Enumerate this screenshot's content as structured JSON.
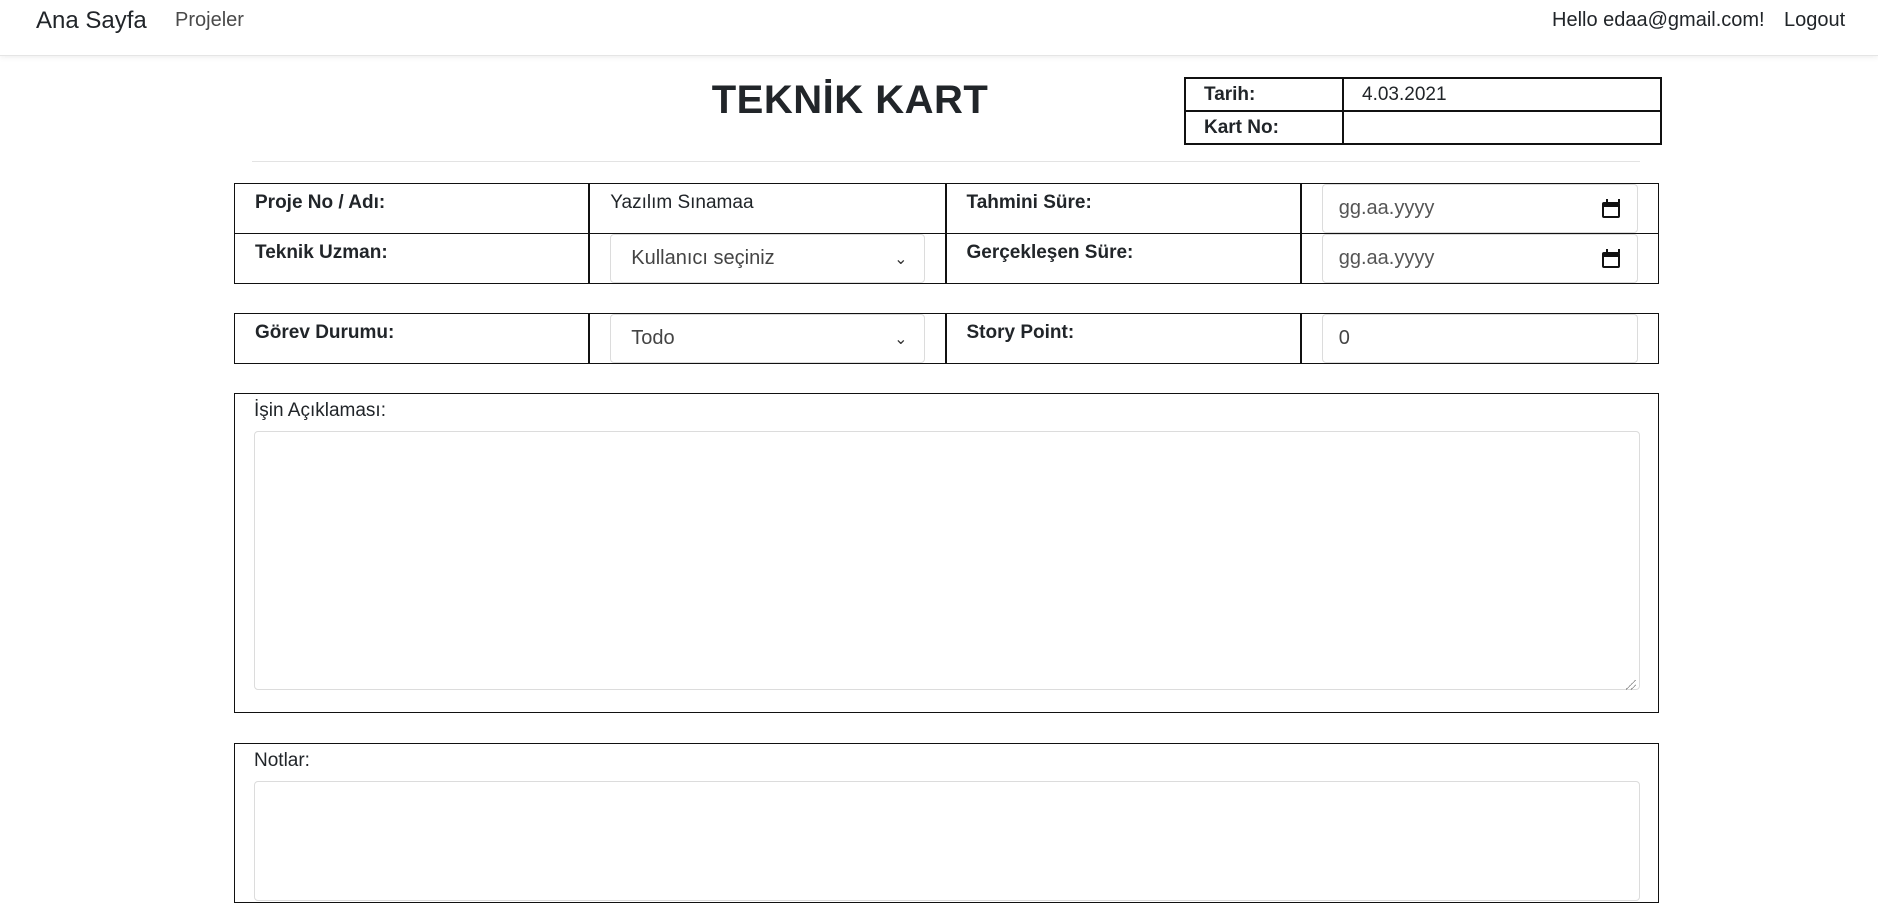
{
  "nav": {
    "brand": "Ana Sayfa",
    "projects": "Projeler",
    "greeting": "Hello edaa@gmail.com!",
    "logout": "Logout"
  },
  "card": {
    "title": "TEKNİK KART",
    "date_label": "Tarih:",
    "date_value": "4.03.2021",
    "card_no_label": "Kart No:",
    "card_no_value": ""
  },
  "form": {
    "project_label": "Proje No / Adı:",
    "project_value": "Yazılım Sınamaa",
    "estimated_label": "Tahmini Süre:",
    "estimated_placeholder": "gg.aa.yyyy",
    "expert_label": "Teknik Uzman:",
    "expert_selected": "Kullanıcı seçiniz",
    "actual_label": "Gerçekleşen Süre:",
    "actual_placeholder": "gg.aa.yyyy",
    "status_label": "Görev Durumu:",
    "status_selected": "Todo",
    "story_label": "Story Point:",
    "story_value": "0",
    "description_label": "İşin Açıklaması:",
    "description_value": "",
    "notes_label": "Notlar:",
    "notes_value": ""
  },
  "icons": {
    "calendar": "calendar-icon",
    "chevron": "chevron-down-icon"
  }
}
